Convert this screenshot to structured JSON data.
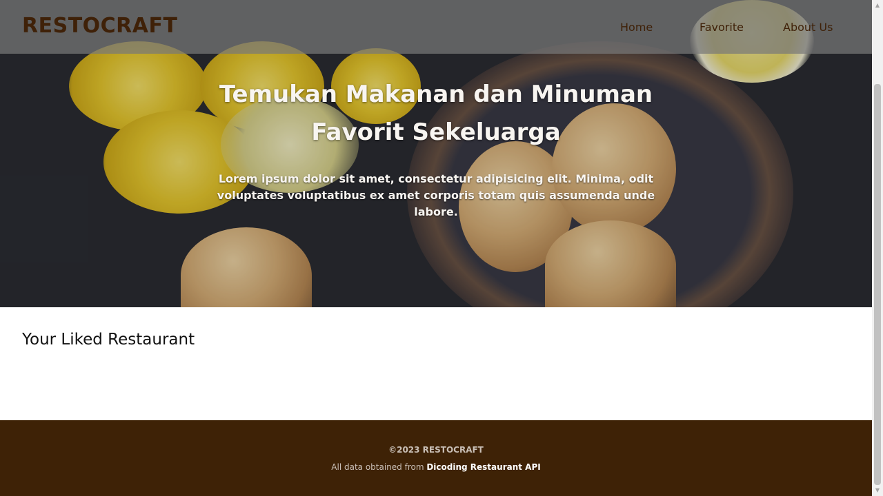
{
  "navbar": {
    "brand": "RESTOCRAFT",
    "links": [
      "Home",
      "Favorite",
      "About Us"
    ]
  },
  "hero": {
    "title": "Temukan Makanan dan Minuman Favorit Sekeluarga",
    "description": "Lorem ipsum dolor sit amet, consectetur adipisicing elit. Minima, odit voluptates voluptatibus ex amet corporis totam quis assumenda unde labore."
  },
  "main": {
    "section_title": "Your Liked Restaurant"
  },
  "footer": {
    "copyright": "©2023 RESTOCRAFT",
    "credit_prefix": "All data obtained from",
    "credit_link": "Dicoding Restaurant API"
  },
  "colors": {
    "brand": "#3f2108",
    "footer_bg": "#3e2206",
    "navbar_bg": "#787878"
  }
}
